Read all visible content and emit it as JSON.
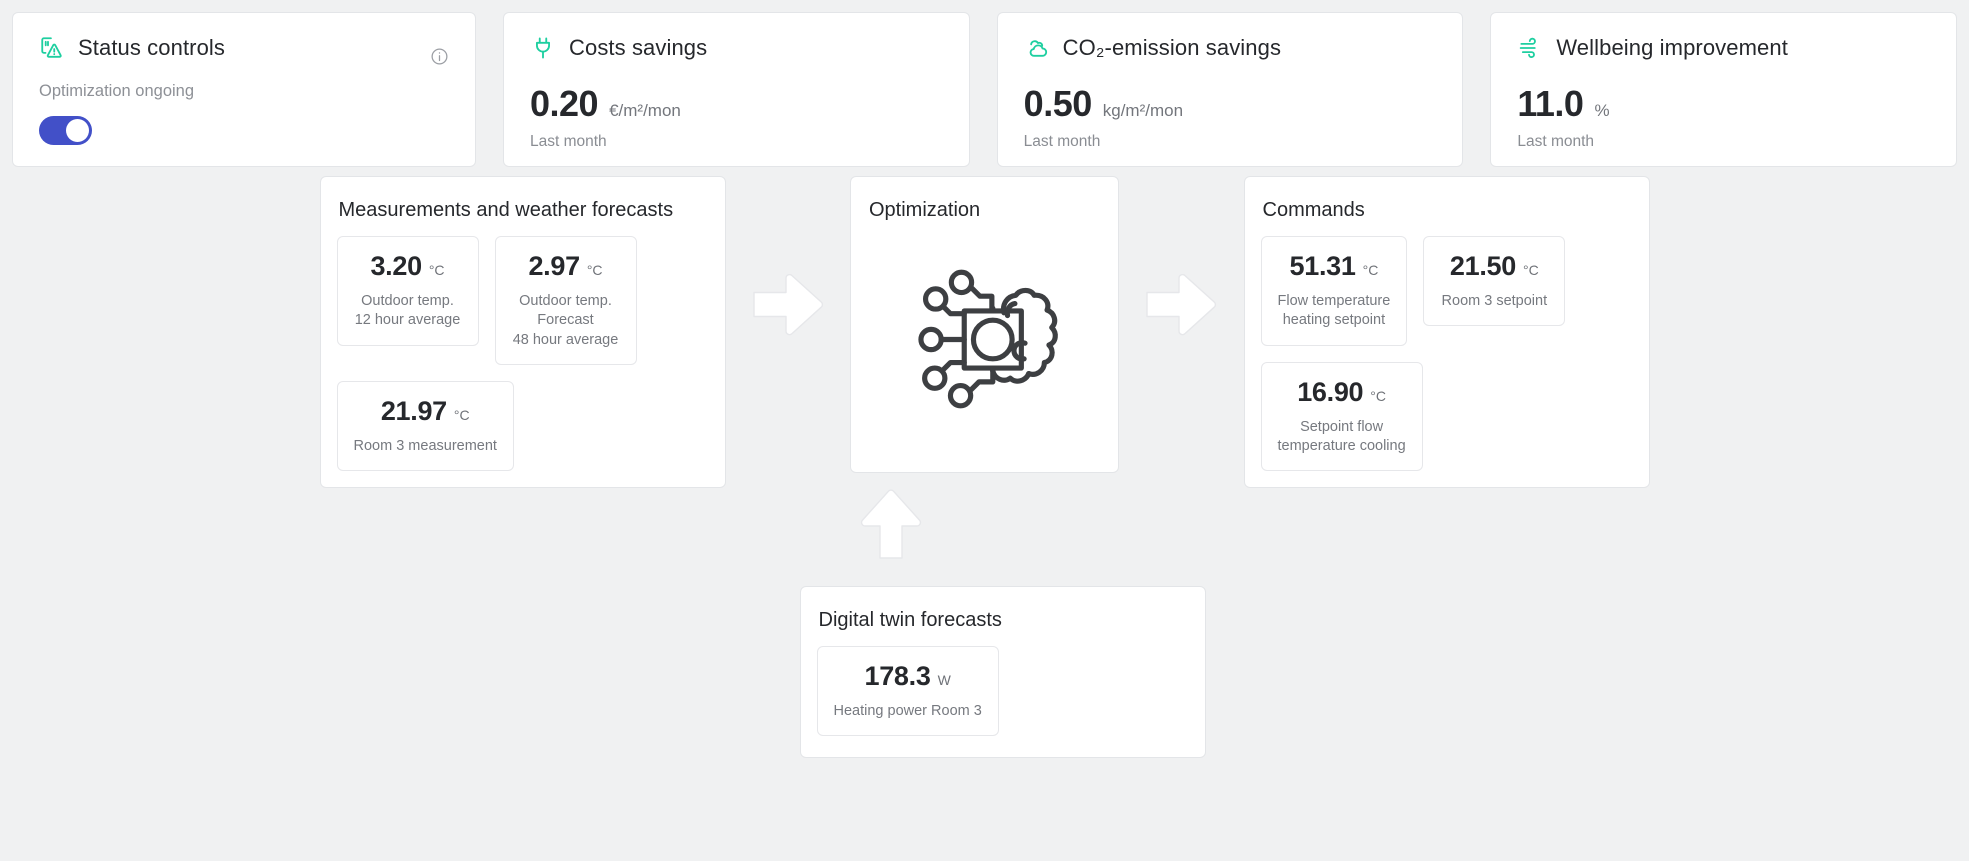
{
  "kpis": [
    {
      "id": "status-controls",
      "icon": "status-warning-icon",
      "title": "Status controls",
      "subtitle": "Optimization ongoing",
      "toggle_on": true,
      "info_icon": "info-icon"
    },
    {
      "id": "costs-savings",
      "icon": "plug-icon",
      "title": "Costs savings",
      "value": "0.20",
      "unit": "€/m²/mon",
      "footnote": "Last month"
    },
    {
      "id": "co2-emission-savings",
      "icon": "cloud-icon",
      "title": "CO₂-emission savings",
      "value": "0.50",
      "unit": "kg/m²/mon",
      "footnote": "Last month"
    },
    {
      "id": "wellbeing-improvement",
      "icon": "wind-icon",
      "title": "Wellbeing improvement",
      "value": "11.0",
      "unit": "%",
      "footnote": "Last month"
    }
  ],
  "flow": {
    "measurements": {
      "title": "Measurements and weather forecasts",
      "tiles": [
        {
          "value": "3.20",
          "unit": "°C",
          "label": "Outdoor temp.\n12 hour average"
        },
        {
          "value": "2.97",
          "unit": "°C",
          "label": "Outdoor temp.\nForecast\n48 hour average"
        },
        {
          "value": "21.97",
          "unit": "°C",
          "label": "Room 3 measurement"
        }
      ]
    },
    "optimization": {
      "title": "Optimization",
      "icon": "ai-chip-brain-icon"
    },
    "commands": {
      "title": "Commands",
      "tiles": [
        {
          "value": "51.31",
          "unit": "°C",
          "label": "Flow temperature\nheating setpoint"
        },
        {
          "value": "21.50",
          "unit": "°C",
          "label": "Room 3 setpoint"
        },
        {
          "value": "16.90",
          "unit": "°C",
          "label": "Setpoint flow\ntemperature cooling"
        }
      ]
    },
    "digital_twin": {
      "title": "Digital twin forecasts",
      "tiles": [
        {
          "value": "178.3",
          "unit": "W",
          "label": "Heating power Room 3"
        }
      ]
    },
    "arrows": {
      "measurements_to_optimization": "arrow-right-icon",
      "optimization_to_commands": "arrow-right-icon",
      "twin_to_optimization": "arrow-up-icon"
    }
  },
  "colors": {
    "accent_teal": "#1ecfa0",
    "toggle_on": "#4250c8",
    "page_bg": "#f0f1f2",
    "card_bg": "#ffffff",
    "border": "#e3e5e8",
    "text_primary": "#26282c",
    "text_muted": "#80838a"
  }
}
